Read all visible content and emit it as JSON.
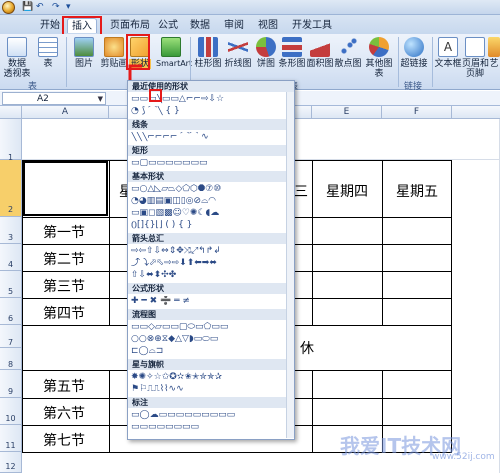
{
  "tabs": [
    "开始",
    "插入",
    "页面布局",
    "公式",
    "数据",
    "审阅",
    "视图",
    "开发工具"
  ],
  "active_tab": "插入",
  "ribbon": {
    "pivot": "数据\n透视表",
    "table": "表",
    "picture": "图片",
    "clipart": "剪贴画",
    "shapes": "形状",
    "smartart": "SmartArt",
    "column": "柱形图",
    "line": "折线图",
    "pie": "饼图",
    "bar": "条形图",
    "area": "面积图",
    "scatter": "散点图",
    "other": "其他图表",
    "hyperlink": "超链接",
    "textbox": "文本框",
    "header": "页眉和\n页脚",
    "art": "艺",
    "group_table": "表",
    "group_chart": "图表",
    "group_link": "链接"
  },
  "namebox": "A2",
  "columns": [
    "A",
    "B",
    "C",
    "D",
    "E",
    "F"
  ],
  "rows": [
    "1",
    "2",
    "3",
    "4",
    "5",
    "6",
    "7",
    "8",
    "9",
    "10",
    "11",
    "12"
  ],
  "cells": {
    "b2_partial": "星",
    "d2_partial": "三",
    "e2": "星期四",
    "f2": "星期五",
    "a3": "第一节",
    "a4": "第二节",
    "a5": "第三节",
    "a6": "第四节",
    "rest_partial": "休",
    "a9": "第五节",
    "a10": "第六节",
    "a11": "第七节"
  },
  "dropdown": {
    "recent": "最近使用的形状",
    "lines": "线条",
    "rect": "矩形",
    "basic": "基本形状",
    "arrows": "箭头总汇",
    "equation": "公式形状",
    "flowchart": "流程图",
    "stars": "星与旗帜",
    "callouts": "标注"
  },
  "watermark": "我爱IT技术网",
  "watermark_url": "www.52ij.com"
}
